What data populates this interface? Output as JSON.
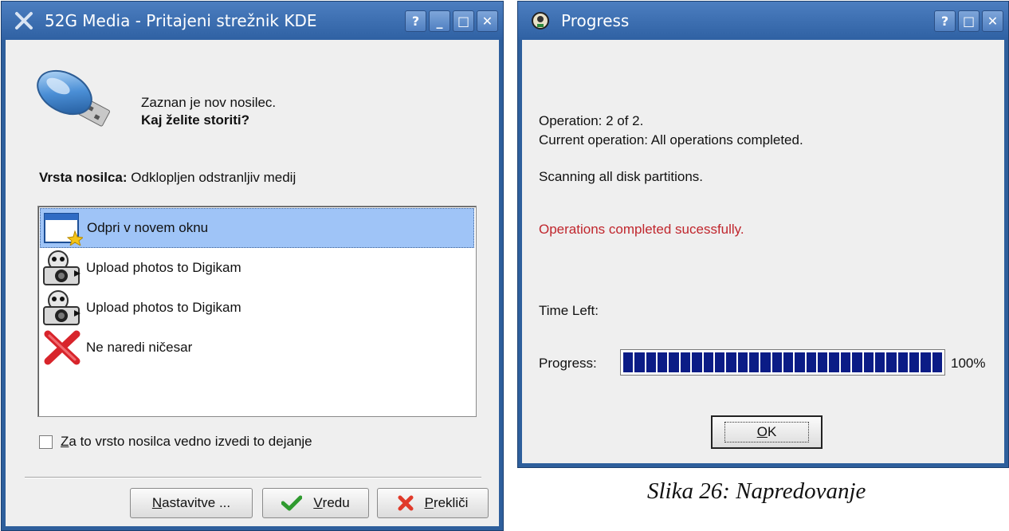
{
  "media_dialog": {
    "title": "52G Media - Pritajeni strežnik KDE",
    "title_buttons": [
      "?",
      "_",
      "□",
      "✕"
    ],
    "detected_text": "Zaznan je nov nosilec.",
    "question": "Kaj želite storiti?",
    "media_type_label": "Vrsta nosilca:",
    "media_type_value": "Odklopljen odstranljiv medij",
    "actions": [
      {
        "label": "Odpri v novem oknu",
        "icon": "new-window-icon",
        "selected": true
      },
      {
        "label": "Upload photos to Digikam",
        "icon": "camera-icon",
        "selected": false
      },
      {
        "label": "Upload photos to Digikam",
        "icon": "camera-icon",
        "selected": false
      },
      {
        "label": "Ne naredi ničesar",
        "icon": "red-x-icon",
        "selected": false
      }
    ],
    "always_do": {
      "mnemonic": "Z",
      "rest": "a to vrsto nosilca vedno izvedi to dejanje",
      "checked": false
    },
    "buttons": {
      "settings": {
        "mnemonic": "N",
        "rest": "astavitve ..."
      },
      "ok": {
        "mnemonic": "V",
        "rest": " redu"
      },
      "cancel": {
        "mnemonic": "P",
        "rest": "rekliči"
      }
    }
  },
  "progress_dialog": {
    "title": "Progress",
    "title_buttons": [
      "?",
      "□",
      "✕"
    ],
    "operation": "Operation: 2 of 2.",
    "current_operation": "Current operation: All operations completed.",
    "status": "Scanning all disk partitions.",
    "result": "Operations completed sucessfully.",
    "time_left_label": "Time Left:",
    "progress_label": "Progress:",
    "progress_value": 1.0,
    "progress_text": "100%",
    "ok": {
      "mnemonic": "O",
      "rest": "K"
    }
  },
  "caption": "Slika 26: Napredovanje",
  "colors": {
    "titlebar": "#2f61a3",
    "selection": "#9fc4f7",
    "progress_fill": "#0b1c86",
    "error_text": "#c0262d"
  }
}
